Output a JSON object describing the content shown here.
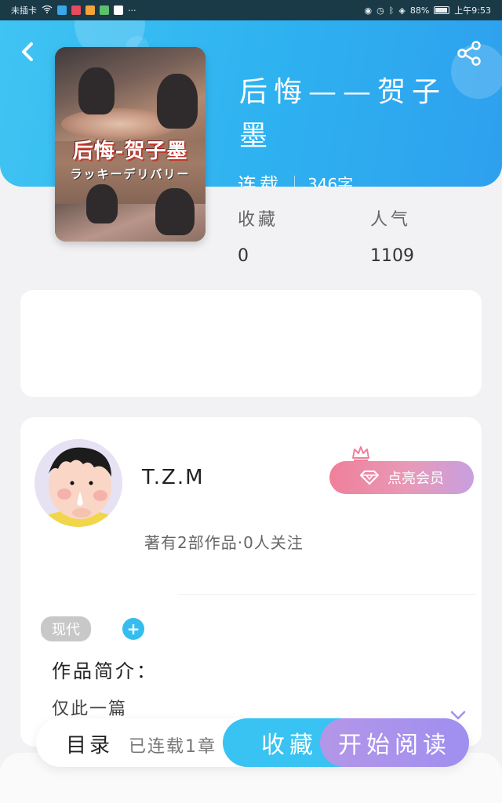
{
  "status_bar": {
    "carrier": "未插卡",
    "battery": "88%",
    "time": "上午9:53"
  },
  "header": {
    "back_icon": "chevron-left-icon",
    "share_icon": "share-icon"
  },
  "cover": {
    "title": "后悔-贺子墨",
    "subtitle": "ラッキーデリバリー"
  },
  "book": {
    "title": "后悔——贺子墨",
    "status": "连载",
    "word_count": "346字"
  },
  "stats": {
    "favorites_label": "收藏",
    "favorites_value": "0",
    "popularity_label": "人气",
    "popularity_value": "1109"
  },
  "author": {
    "name": "T.Z.M",
    "meta": "著有2部作品·0人关注",
    "vip_label": "点亮会员"
  },
  "tags": [
    "现代"
  ],
  "intro": {
    "title": "作品简介：",
    "text": "仅此一篇"
  },
  "bottom_bar": {
    "toc_label": "目录",
    "chapter_count": "已连载1章",
    "favorite_label": "收藏",
    "read_label": "开始阅读"
  },
  "colors": {
    "header_blue": "#2eb1f0",
    "favorite_button": "#38c3f2",
    "read_button": "#a58ff0",
    "vip_pink": "#f07f9a"
  }
}
